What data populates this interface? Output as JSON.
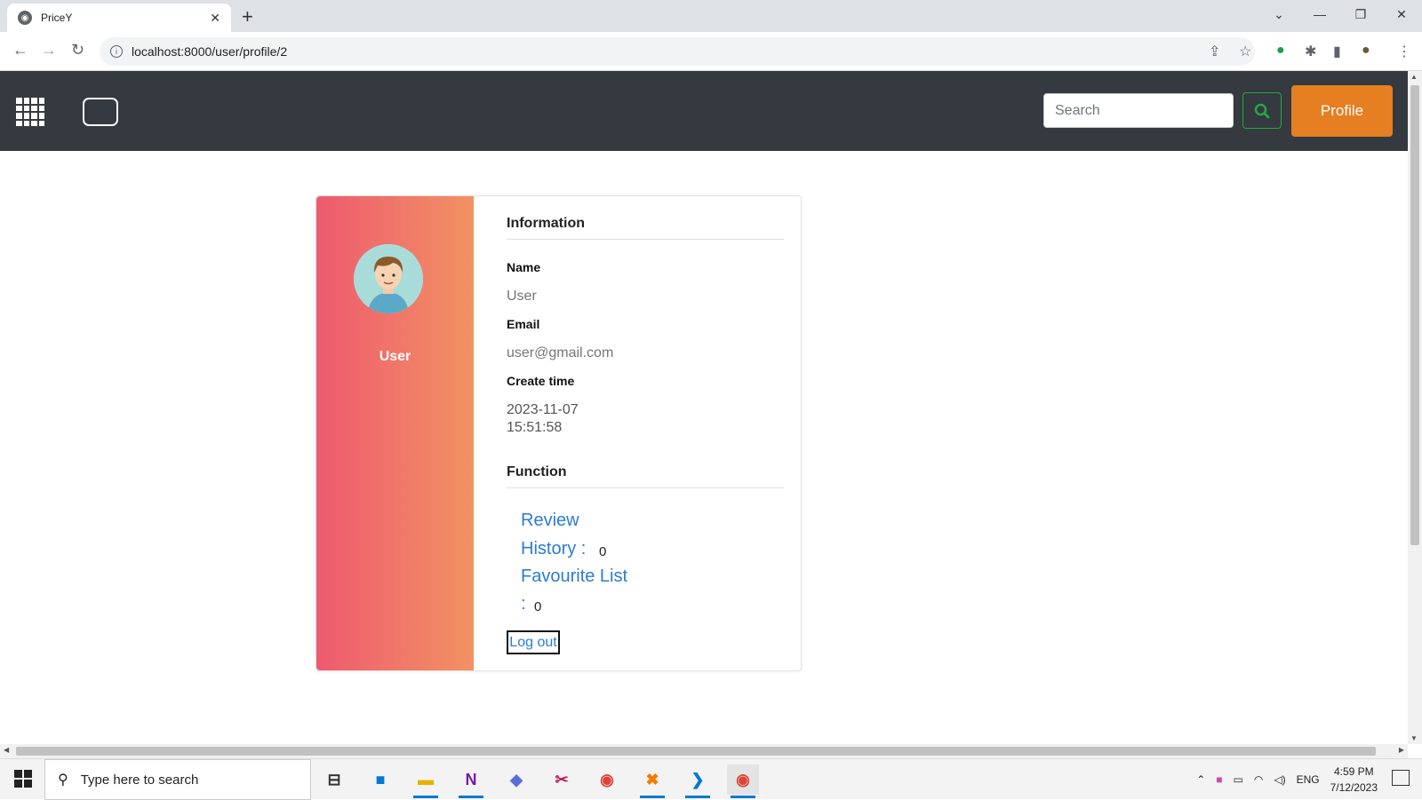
{
  "browser": {
    "tab_title": "PriceY",
    "url": "localhost:8000/user/profile/2"
  },
  "navbar": {
    "search_placeholder": "Search",
    "profile_label": "Profile"
  },
  "profile": {
    "display_name": "User",
    "info_heading": "Information",
    "name_label": "Name",
    "name_value": "User",
    "email_label": "Email",
    "email_value": "user@gmail.com",
    "create_label": "Create time",
    "create_date": "2023-11-07",
    "create_time": "15:51:58",
    "function_heading": "Function",
    "review_history_line1": "Review",
    "review_history_line2": "History :",
    "review_history_count": "0",
    "favourite_line1": "Favourite List",
    "favourite_line2": ":",
    "favourite_count": "0",
    "logout_label": "Log out"
  },
  "taskbar": {
    "search_placeholder": "Type here to search",
    "language": "ENG",
    "time": "4:59 PM",
    "date": "7/12/2023"
  },
  "colors": {
    "navbar_bg": "#343a40",
    "profile_button": "#e67e22",
    "gradient_start": "#ee5a6f",
    "gradient_end": "#f29263",
    "link": "#2b7cd3",
    "search_button_border": "#28a745"
  }
}
